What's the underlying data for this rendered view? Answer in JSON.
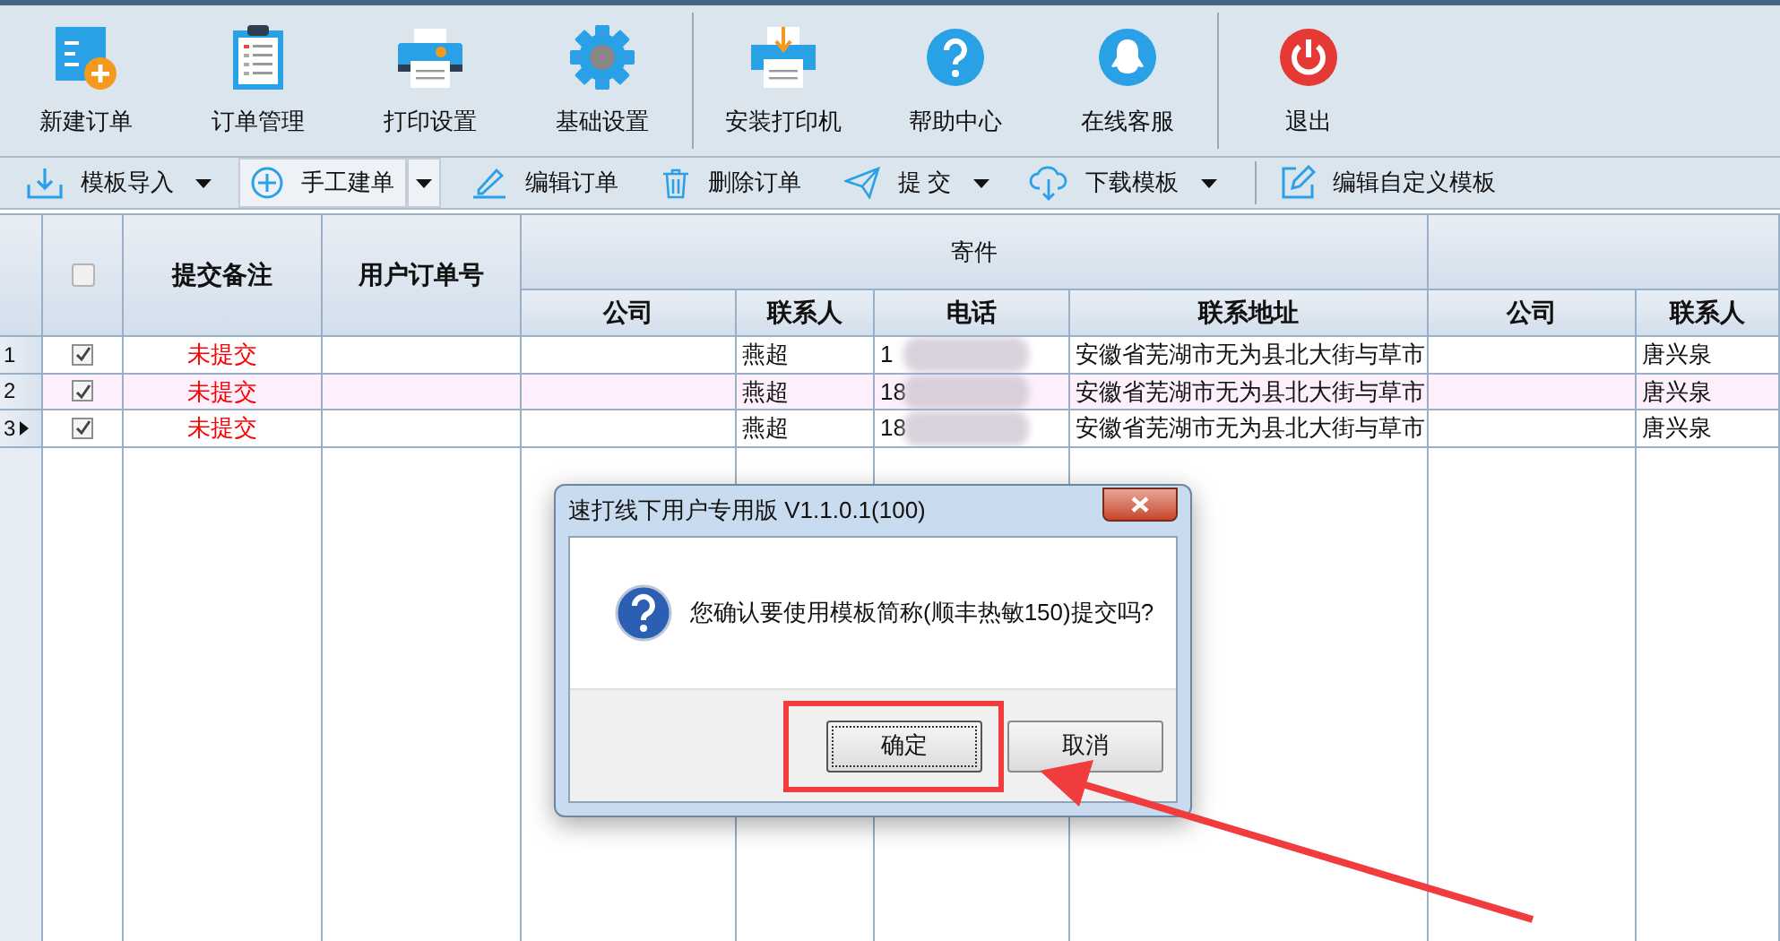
{
  "toolbar": {
    "groups": [
      {
        "buttons": [
          {
            "label": "新建订单"
          },
          {
            "label": "订单管理"
          },
          {
            "label": "打印设置"
          },
          {
            "label": "基础设置"
          }
        ]
      },
      {
        "buttons": [
          {
            "label": "安装打印机"
          },
          {
            "label": "帮助中心"
          },
          {
            "label": "在线客服"
          }
        ]
      },
      {
        "buttons": [
          {
            "label": "退出"
          }
        ]
      }
    ]
  },
  "action_bar": {
    "groups": [
      {
        "items": [
          {
            "label": "模板导入",
            "has_dropdown": true,
            "pressed": false
          },
          {
            "label": "手工建单",
            "has_dropdown": true,
            "pressed": true
          },
          {
            "label": "编辑订单",
            "has_dropdown": false,
            "pressed": false
          },
          {
            "label": "删除订单",
            "has_dropdown": false,
            "pressed": false
          },
          {
            "label": "提 交",
            "has_dropdown": true,
            "pressed": false
          },
          {
            "label": "下载模板",
            "has_dropdown": true,
            "pressed": false
          }
        ]
      },
      {
        "items": [
          {
            "label": "编辑自定义模板",
            "has_dropdown": false,
            "pressed": false
          }
        ]
      }
    ]
  },
  "table": {
    "header_checkbox": {
      "checked": false
    },
    "columns": [
      "提交备注",
      "用户订单号"
    ],
    "sender_group": {
      "title": "寄件",
      "columns": [
        "公司",
        "联系人",
        "电话",
        "联系地址"
      ]
    },
    "column_group_2": {
      "columns": [
        "公司",
        "联系人"
      ]
    },
    "rows": [
      {
        "number": "1",
        "current": false,
        "selected": false,
        "checked": true,
        "status": "未提交",
        "sender_contact": "燕超",
        "sender_phone": "1",
        "sender_address": "安徽省芜湖市无为县北大街与草市",
        "receiver_contact": "唐兴泉"
      },
      {
        "number": "2",
        "current": false,
        "selected": true,
        "checked": true,
        "status": "未提交",
        "sender_contact": "燕超",
        "sender_phone": "18",
        "sender_address": "安徽省芜湖市无为县北大街与草市",
        "receiver_contact": "唐兴泉"
      },
      {
        "number": "3",
        "current": true,
        "selected": false,
        "checked": true,
        "status": "未提交",
        "sender_contact": "燕超",
        "sender_phone": "18",
        "sender_address": "安徽省芜湖市无为县北大街与草市",
        "receiver_contact": "唐兴泉"
      }
    ]
  },
  "dialog": {
    "title": "速打线下用户专用版 V1.1.0.1(100)",
    "message": "您确认要使用模板简称(顺丰热敏150)提交吗?",
    "buttons": [
      {
        "label": "确定",
        "focused": true
      },
      {
        "label": "取消",
        "focused": false
      }
    ]
  }
}
